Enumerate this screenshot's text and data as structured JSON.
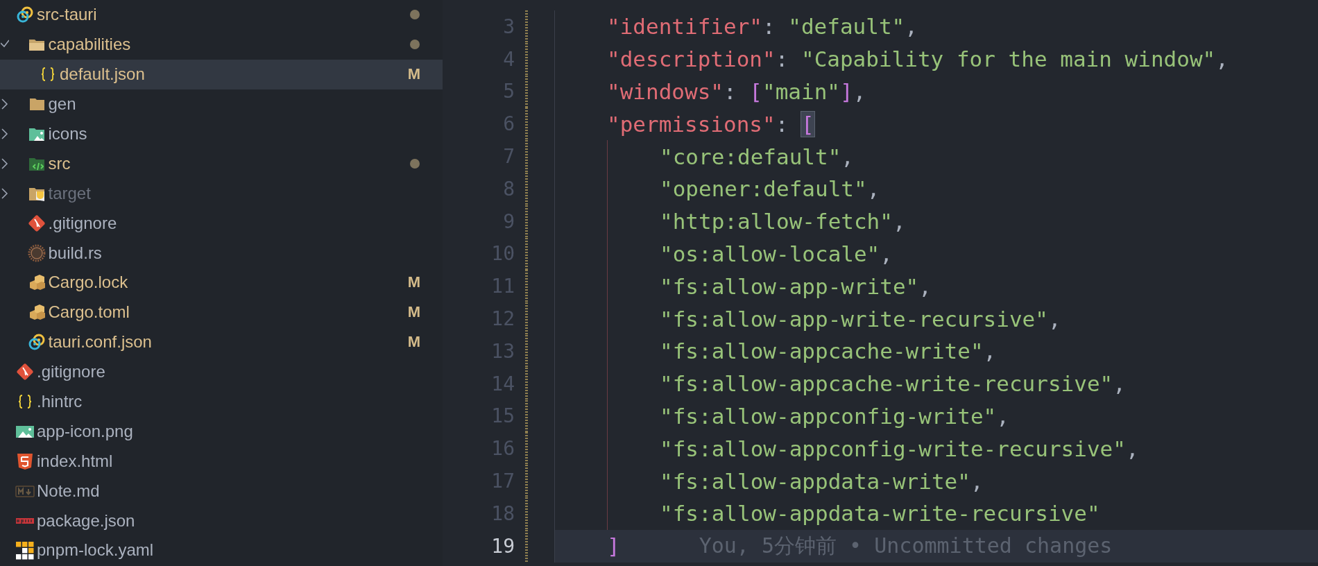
{
  "explorer": {
    "items": [
      {
        "name": "src-tauri",
        "kind": "tauri",
        "modified": true,
        "ignored": false,
        "dot": true,
        "selected": false,
        "children": [
          {
            "name": "capabilities",
            "kind": "folder-open",
            "modified": true,
            "ignored": false,
            "dot": true,
            "selected": false,
            "expanded": true,
            "children": [
              {
                "name": "default.json",
                "kind": "json",
                "modified": true,
                "ignored": false,
                "dot": false,
                "badge": "M",
                "selected": true
              }
            ]
          },
          {
            "name": "gen",
            "kind": "folder",
            "modified": false,
            "ignored": false,
            "dot": false,
            "selected": false,
            "expanded": false
          },
          {
            "name": "icons",
            "kind": "image-folder",
            "modified": false,
            "ignored": false,
            "dot": false,
            "selected": false,
            "expanded": false
          },
          {
            "name": "src",
            "kind": "code-folder",
            "modified": true,
            "ignored": false,
            "dot": true,
            "selected": false,
            "expanded": false
          },
          {
            "name": "target",
            "kind": "target-folder",
            "modified": false,
            "ignored": true,
            "dot": false,
            "selected": false,
            "expanded": false
          },
          {
            "name": ".gitignore",
            "kind": "git",
            "modified": false,
            "ignored": false,
            "dot": false,
            "selected": false
          },
          {
            "name": "build.rs",
            "kind": "rust",
            "modified": false,
            "ignored": false,
            "dot": false,
            "selected": false
          },
          {
            "name": "Cargo.lock",
            "kind": "cargo",
            "modified": true,
            "ignored": false,
            "dot": false,
            "badge": "M",
            "selected": false
          },
          {
            "name": "Cargo.toml",
            "kind": "cargo",
            "modified": true,
            "ignored": false,
            "dot": false,
            "badge": "M",
            "selected": false
          },
          {
            "name": "tauri.conf.json",
            "kind": "tauri",
            "modified": true,
            "ignored": false,
            "dot": false,
            "badge": "M",
            "selected": false
          }
        ]
      },
      {
        "name": ".gitignore",
        "kind": "git",
        "modified": false,
        "ignored": false,
        "dot": false,
        "selected": false
      },
      {
        "name": ".hintrc",
        "kind": "json",
        "modified": false,
        "ignored": false,
        "dot": false,
        "selected": false
      },
      {
        "name": "app-icon.png",
        "kind": "image",
        "modified": false,
        "ignored": false,
        "dot": false,
        "selected": false
      },
      {
        "name": "index.html",
        "kind": "html",
        "modified": false,
        "ignored": false,
        "dot": false,
        "selected": false
      },
      {
        "name": "Note.md",
        "kind": "markdown",
        "modified": false,
        "ignored": false,
        "dot": false,
        "selected": false
      },
      {
        "name": "package.json",
        "kind": "npm",
        "modified": false,
        "ignored": false,
        "dot": false,
        "selected": false
      },
      {
        "name": "pnpm-lock.yaml",
        "kind": "pnpm",
        "modified": false,
        "ignored": false,
        "dot": false,
        "selected": false
      }
    ]
  },
  "editor": {
    "lines": [
      {
        "number": "3",
        "changed": true,
        "current": false,
        "tokens": [
          {
            "kind": "key",
            "text": "\"identifier\""
          },
          {
            "kind": "punct",
            "text": ": "
          },
          {
            "kind": "string",
            "text": "\"default\""
          },
          {
            "kind": "punct",
            "text": ","
          }
        ]
      },
      {
        "number": "4",
        "changed": true,
        "current": false,
        "tokens": [
          {
            "kind": "key",
            "text": "\"description\""
          },
          {
            "kind": "punct",
            "text": ": "
          },
          {
            "kind": "string",
            "text": "\"Capability for the main window\""
          },
          {
            "kind": "punct",
            "text": ","
          }
        ]
      },
      {
        "number": "5",
        "changed": true,
        "current": false,
        "tokens": [
          {
            "kind": "key",
            "text": "\"windows\""
          },
          {
            "kind": "punct",
            "text": ": "
          },
          {
            "kind": "bracket",
            "text": "["
          },
          {
            "kind": "string",
            "text": "\"main\""
          },
          {
            "kind": "bracket",
            "text": "]"
          },
          {
            "kind": "punct",
            "text": ","
          }
        ]
      },
      {
        "number": "6",
        "changed": true,
        "current": false,
        "tokens": [
          {
            "kind": "key",
            "text": "\"permissions\""
          },
          {
            "kind": "punct",
            "text": ": "
          },
          {
            "kind": "bracket-match",
            "text": "["
          }
        ],
        "children": [
          {
            "number": "7",
            "changed": true,
            "current": false,
            "tokens": [
              {
                "kind": "string",
                "text": "\"core:default\""
              },
              {
                "kind": "punct",
                "text": ","
              }
            ]
          },
          {
            "number": "8",
            "changed": true,
            "current": false,
            "tokens": [
              {
                "kind": "string",
                "text": "\"opener:default\""
              },
              {
                "kind": "punct",
                "text": ","
              }
            ]
          },
          {
            "number": "9",
            "changed": true,
            "current": false,
            "tokens": [
              {
                "kind": "string",
                "text": "\"http:allow-fetch\""
              },
              {
                "kind": "punct",
                "text": ","
              }
            ]
          },
          {
            "number": "10",
            "changed": true,
            "current": false,
            "tokens": [
              {
                "kind": "string",
                "text": "\"os:allow-locale\""
              },
              {
                "kind": "punct",
                "text": ","
              }
            ]
          },
          {
            "number": "11",
            "changed": true,
            "current": false,
            "tokens": [
              {
                "kind": "string",
                "text": "\"fs:allow-app-write\""
              },
              {
                "kind": "punct",
                "text": ","
              }
            ]
          },
          {
            "number": "12",
            "changed": true,
            "current": false,
            "tokens": [
              {
                "kind": "string",
                "text": "\"fs:allow-app-write-recursive\""
              },
              {
                "kind": "punct",
                "text": ","
              }
            ]
          },
          {
            "number": "13",
            "changed": true,
            "current": false,
            "tokens": [
              {
                "kind": "string",
                "text": "\"fs:allow-appcache-write\""
              },
              {
                "kind": "punct",
                "text": ","
              }
            ]
          },
          {
            "number": "14",
            "changed": true,
            "current": false,
            "tokens": [
              {
                "kind": "string",
                "text": "\"fs:allow-appcache-write-recursive\""
              },
              {
                "kind": "punct",
                "text": ","
              }
            ]
          },
          {
            "number": "15",
            "changed": true,
            "current": false,
            "tokens": [
              {
                "kind": "string",
                "text": "\"fs:allow-appconfig-write\""
              },
              {
                "kind": "punct",
                "text": ","
              }
            ]
          },
          {
            "number": "16",
            "changed": true,
            "current": false,
            "tokens": [
              {
                "kind": "string",
                "text": "\"fs:allow-appconfig-write-recursive\""
              },
              {
                "kind": "punct",
                "text": ","
              }
            ]
          },
          {
            "number": "17",
            "changed": true,
            "current": false,
            "tokens": [
              {
                "kind": "string",
                "text": "\"fs:allow-appdata-write\""
              },
              {
                "kind": "punct",
                "text": ","
              }
            ]
          },
          {
            "number": "18",
            "changed": true,
            "current": false,
            "tokens": [
              {
                "kind": "string",
                "text": "\"fs:allow-appdata-write-recursive\""
              }
            ]
          }
        ]
      },
      {
        "number": "19",
        "changed": true,
        "current": true,
        "tokens": [
          {
            "kind": "bracket",
            "text": "]"
          }
        ],
        "blame": "You, 5分钟前 • Uncommitted changes"
      }
    ]
  }
}
